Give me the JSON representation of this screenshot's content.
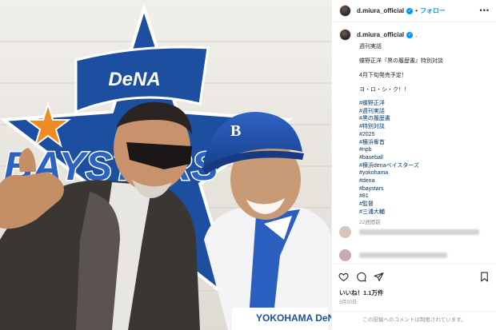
{
  "post": {
    "username": "d.miura_official",
    "follow_label": "フォロー",
    "more_label": "•••"
  },
  "photo": {
    "logo_text": "DeNA",
    "wordmark_text": "BAYSTARS",
    "cap_logo": "B",
    "jersey_text": "YOKOHAMA DeNA",
    "colors": {
      "baystars_blue": "#1d4fa0",
      "star_orange": "#f08a23",
      "wall": "#e9e7e2"
    }
  },
  "caption": {
    "username": "d.miura_official",
    "lines": [
      "週刊実話",
      "蝶野正洋『黒の履歴書』特別対談",
      "4月下旬発売予定！",
      "ヨ・ロ・シ・ク！！"
    ],
    "hashtags": [
      "#蝶野正洋",
      "#週刊実話",
      "#黒の履歴書",
      "#特別対談",
      "#2025",
      "#横浜奪首",
      "#npb",
      "#baseball",
      "#横浜denaベイスターズ",
      "#yokohama",
      "#dena",
      "#baystars",
      "#81",
      "#監督",
      "#三浦大輔"
    ],
    "time_ago": "22週間前"
  },
  "actions": {
    "icons": [
      "heart-icon",
      "comment-icon",
      "share-icon",
      "bookmark-icon"
    ],
    "likes_label": "いいね！1.1万件",
    "date_label": "3月20日",
    "comments_closed": "この投稿へのコメントは制限されています。"
  },
  "colors": {
    "link": "#00376b",
    "accent": "#0095f6",
    "muted": "#8e8e8e"
  }
}
